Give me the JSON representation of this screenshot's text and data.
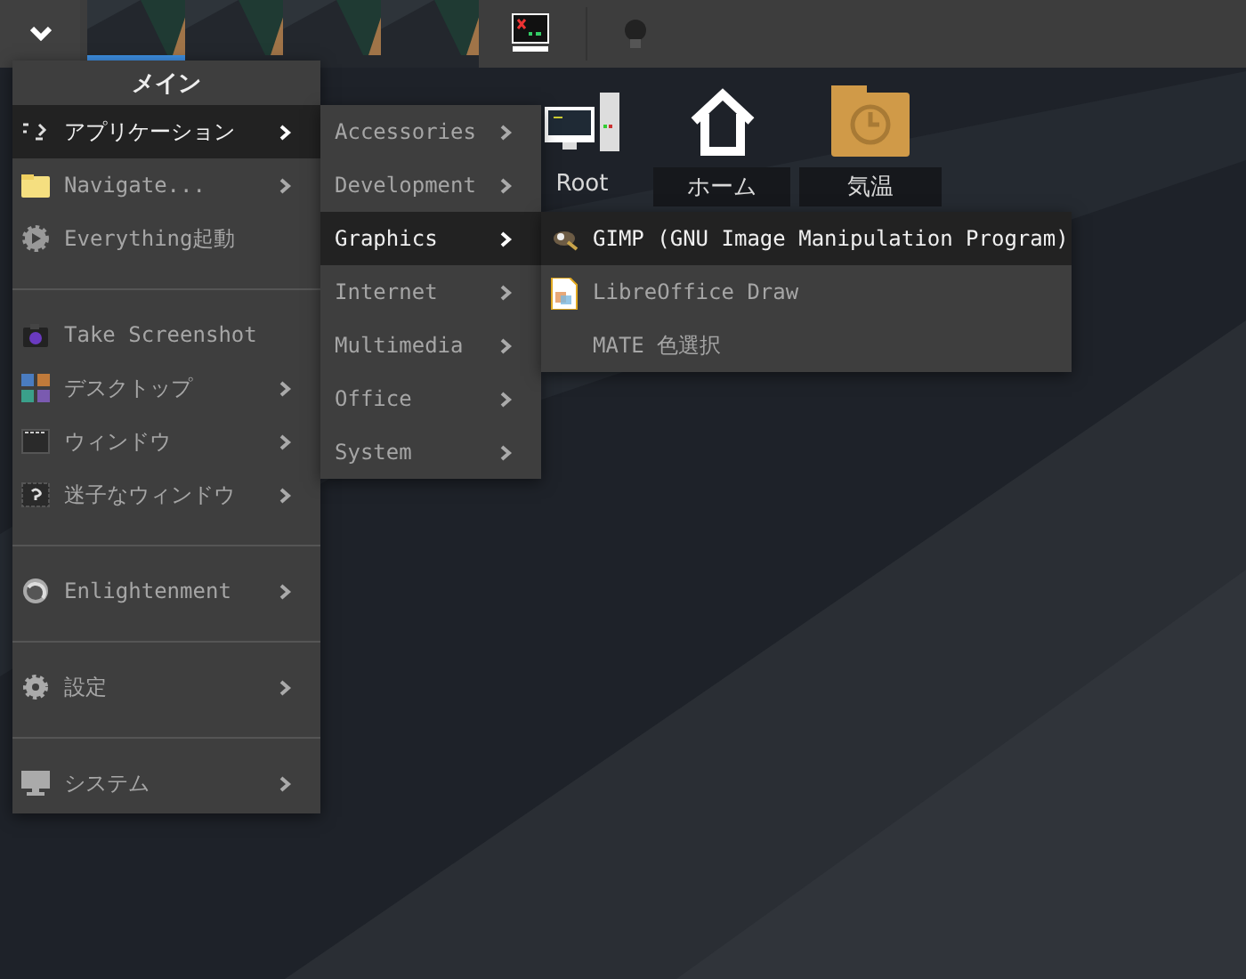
{
  "top_bar": {
    "workspaces": [
      {
        "selected": true
      },
      {
        "selected": false
      },
      {
        "selected": false
      },
      {
        "selected": false
      }
    ]
  },
  "desktop_icons": [
    {
      "label": "Root"
    },
    {
      "label": "ホーム"
    },
    {
      "label": "気温"
    }
  ],
  "main_menu": {
    "title": "メイン",
    "sections": [
      [
        {
          "label": "アプリケーション",
          "submenu": true,
          "selected": true
        },
        {
          "label": "Navigate...",
          "submenu": true,
          "selected": false
        },
        {
          "label": "Everything起動",
          "submenu": false,
          "selected": false
        }
      ],
      [
        {
          "label": "Take Screenshot",
          "submenu": false,
          "selected": false
        },
        {
          "label": "デスクトップ",
          "submenu": true,
          "selected": false
        },
        {
          "label": "ウィンドウ",
          "submenu": true,
          "selected": false
        },
        {
          "label": "迷子なウィンドウ",
          "submenu": true,
          "selected": false
        }
      ],
      [
        {
          "label": "Enlightenment",
          "submenu": true,
          "selected": false
        }
      ],
      [
        {
          "label": "設定",
          "submenu": true,
          "selected": false
        }
      ],
      [
        {
          "label": "システム",
          "submenu": true,
          "selected": false
        }
      ]
    ]
  },
  "applications_menu": {
    "items": [
      {
        "label": "Accessories",
        "submenu": true,
        "selected": false
      },
      {
        "label": "Development",
        "submenu": true,
        "selected": false
      },
      {
        "label": "Graphics",
        "submenu": true,
        "selected": true
      },
      {
        "label": "Internet",
        "submenu": true,
        "selected": false
      },
      {
        "label": "Multimedia",
        "submenu": true,
        "selected": false
      },
      {
        "label": "Office",
        "submenu": true,
        "selected": false
      },
      {
        "label": "System",
        "submenu": true,
        "selected": false
      }
    ]
  },
  "graphics_menu": {
    "items": [
      {
        "label": "GIMP (GNU Image Manipulation Program)",
        "selected": true
      },
      {
        "label": "LibreOffice Draw",
        "selected": false
      },
      {
        "label": "MATE 色選択",
        "selected": false
      }
    ]
  }
}
